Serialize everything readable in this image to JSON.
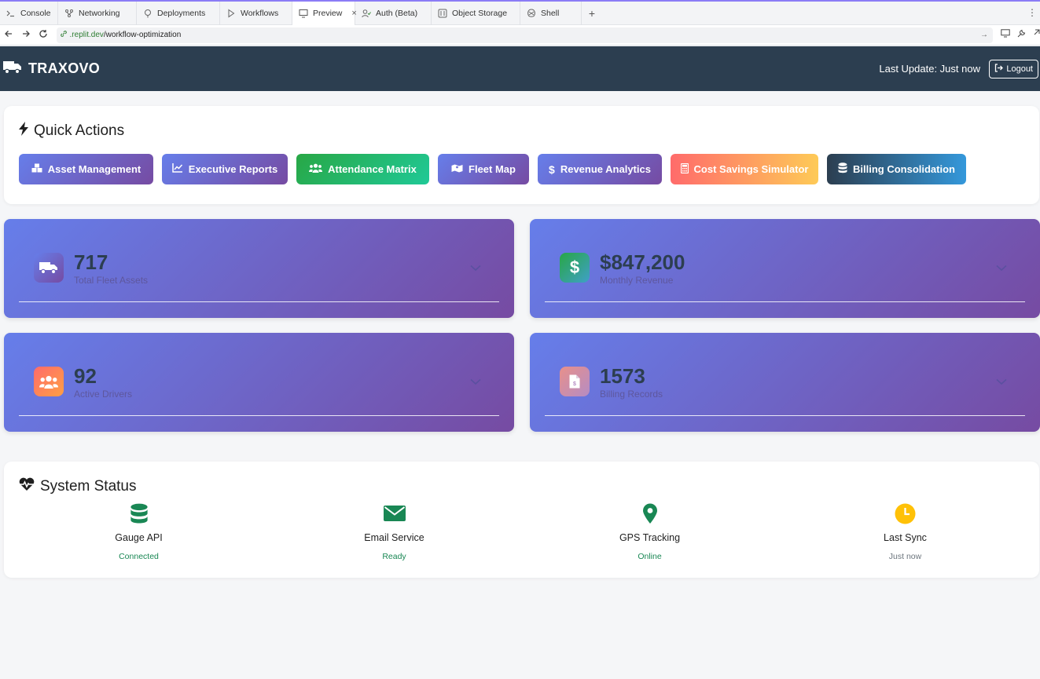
{
  "browser": {
    "tabs": [
      {
        "label": "Console",
        "icon": "terminal-icon"
      },
      {
        "label": "Networking",
        "icon": "network-icon"
      },
      {
        "label": "Deployments",
        "icon": "deploy-icon"
      },
      {
        "label": "Workflows",
        "icon": "play-icon"
      },
      {
        "label": "Preview",
        "icon": "monitor-icon",
        "active": true
      },
      {
        "label": "Auth (Beta)",
        "icon": "user-check-icon"
      },
      {
        "label": "Object Storage",
        "icon": "storage-icon"
      },
      {
        "label": "Shell",
        "icon": "shell-icon"
      }
    ],
    "close_glyph": "×",
    "add_tab_glyph": "+",
    "more_glyph": "⋮",
    "url_host": ".replit.dev",
    "url_path": "/workflow-optimization"
  },
  "header": {
    "brand": "TRAXOVO",
    "last_update": "Last Update: Just now",
    "logout_label": "Logout"
  },
  "quick_actions": {
    "title": "Quick Actions",
    "buttons": [
      {
        "label": "Asset Management",
        "icon": "boxes-icon"
      },
      {
        "label": "Executive Reports",
        "icon": "line-chart-icon"
      },
      {
        "label": "Attendance Matrix",
        "icon": "users-icon"
      },
      {
        "label": "Fleet Map",
        "icon": "map-icon"
      },
      {
        "label": "Revenue Analytics",
        "icon": "dollar-icon"
      },
      {
        "label": "Cost Savings Simulator",
        "icon": "calculator-icon"
      },
      {
        "label": "Billing Consolidation",
        "icon": "database-icon"
      }
    ]
  },
  "metrics": [
    {
      "value": "717",
      "label": "Total Fleet Assets",
      "icon": "truck-icon"
    },
    {
      "value": "$847,200",
      "label": "Monthly Revenue",
      "icon": "dollar-icon"
    },
    {
      "value": "92",
      "label": "Active Drivers",
      "icon": "users-icon"
    },
    {
      "value": "1573",
      "label": "Billing Records",
      "icon": "invoice-icon"
    }
  ],
  "system_status": {
    "title": "System Status",
    "items": [
      {
        "name": "Gauge API",
        "state": "Connected",
        "icon": "database-icon",
        "color": "#198754"
      },
      {
        "name": "Email Service",
        "state": "Ready",
        "icon": "envelope-icon",
        "color": "#198754"
      },
      {
        "name": "GPS Tracking",
        "state": "Online",
        "icon": "map-pin-icon",
        "color": "#198754"
      },
      {
        "name": "Last Sync",
        "state": "Just now",
        "icon": "clock-icon",
        "color": "#ffc107"
      }
    ]
  },
  "colors": {
    "header_bg": "#2c3e50",
    "status_ok": "#198754",
    "status_muted": "#6c757d"
  }
}
